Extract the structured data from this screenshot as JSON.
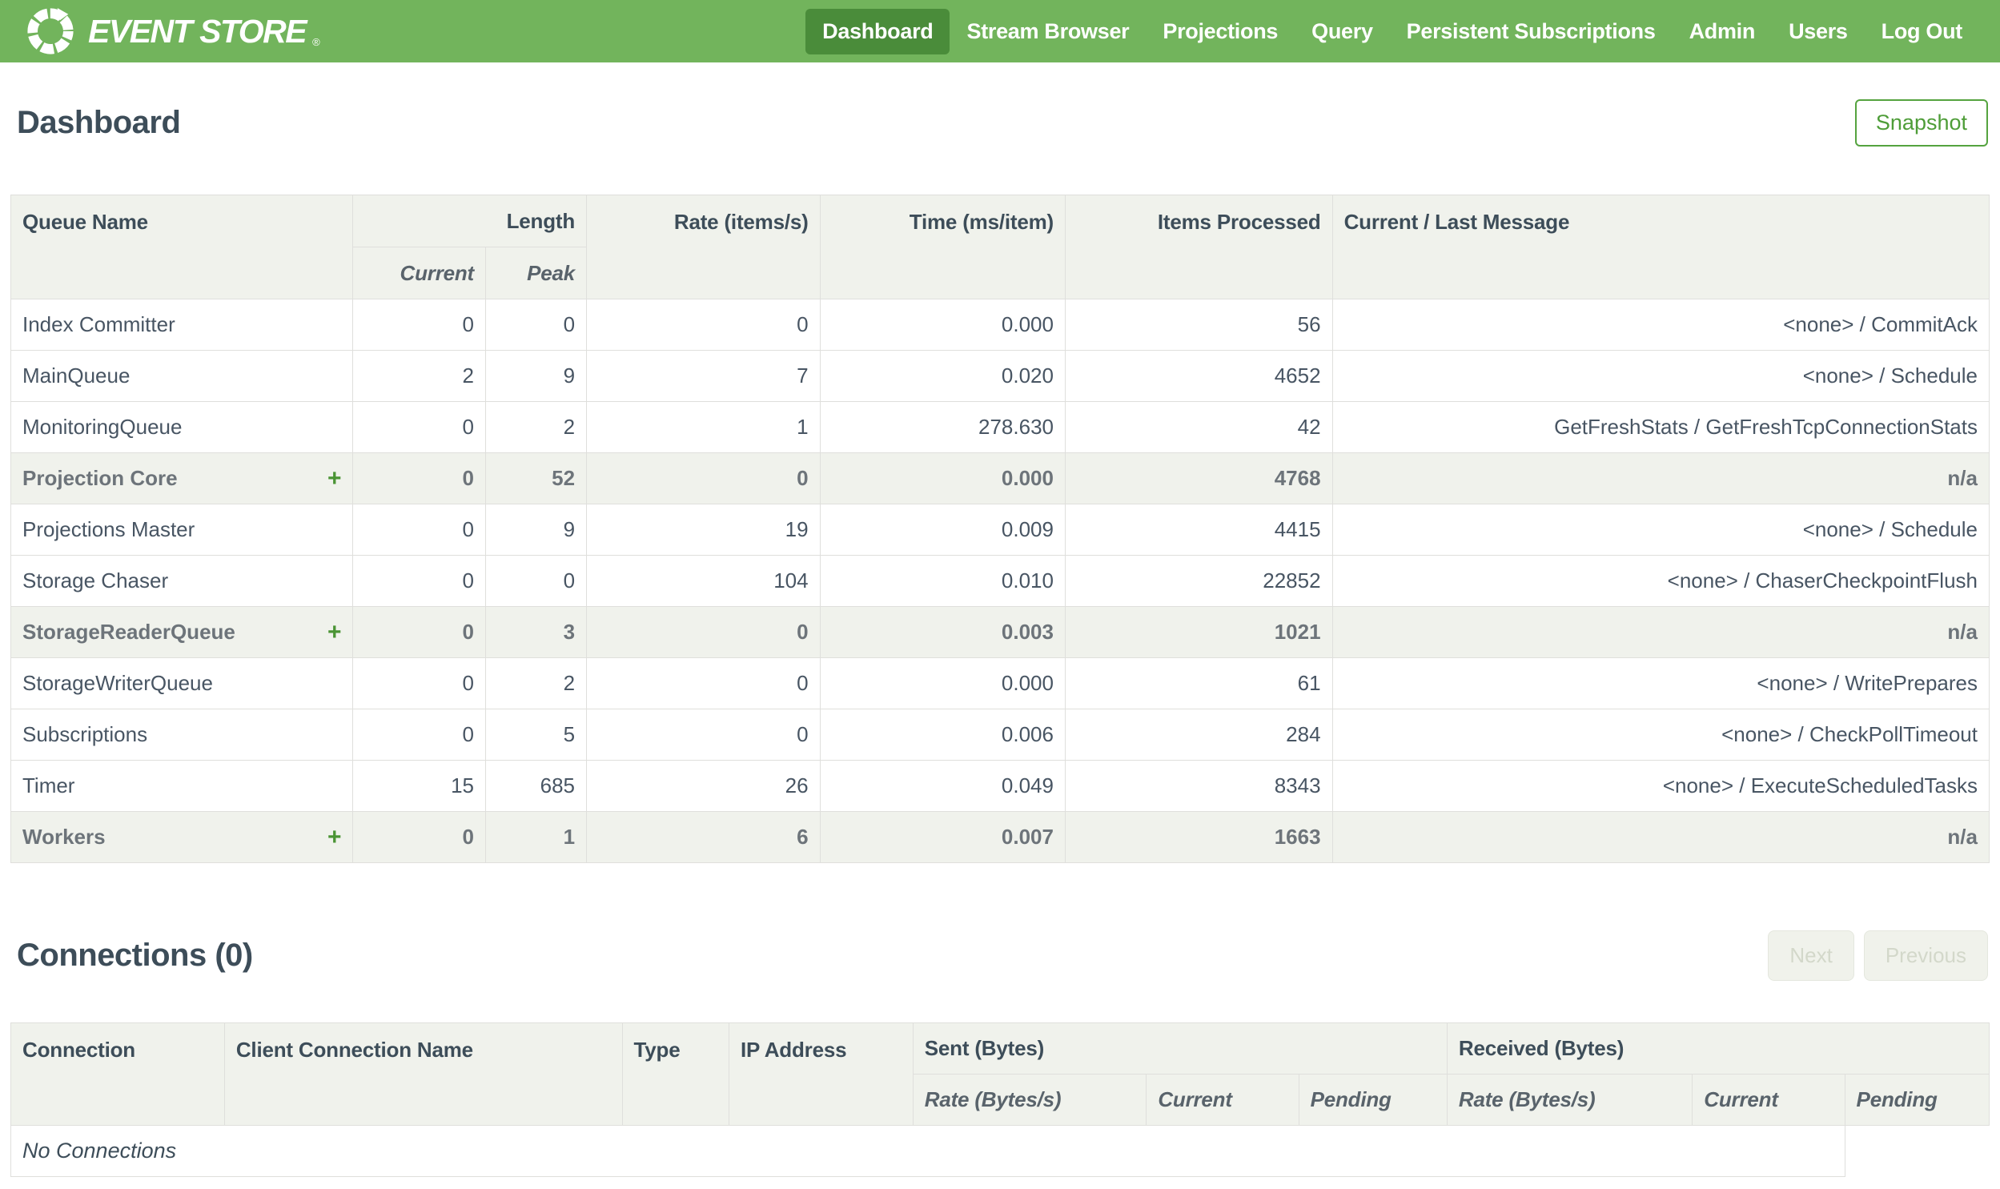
{
  "navbar": {
    "brand": "EVENT STORE",
    "brand_reg": "®",
    "items": [
      {
        "label": "Dashboard",
        "active": true
      },
      {
        "label": "Stream Browser",
        "active": false
      },
      {
        "label": "Projections",
        "active": false
      },
      {
        "label": "Query",
        "active": false
      },
      {
        "label": "Persistent Subscriptions",
        "active": false
      },
      {
        "label": "Admin",
        "active": false
      },
      {
        "label": "Users",
        "active": false
      },
      {
        "label": "Log Out",
        "active": false
      }
    ]
  },
  "page": {
    "title": "Dashboard",
    "snapshot_button": "Snapshot"
  },
  "queues": {
    "headers": {
      "queue_name": "Queue Name",
      "length": "Length",
      "current": "Current",
      "peak": "Peak",
      "rate": "Rate (items/s)",
      "time": "Time (ms/item)",
      "items_processed": "Items Processed",
      "message": "Current / Last Message"
    },
    "rows": [
      {
        "name": "Index Committer",
        "group": false,
        "expander": "",
        "current": "0",
        "peak": "0",
        "rate": "0",
        "time": "0.000",
        "items": "56",
        "message": "<none> / CommitAck"
      },
      {
        "name": "MainQueue",
        "group": false,
        "expander": "",
        "current": "2",
        "peak": "9",
        "rate": "7",
        "time": "0.020",
        "items": "4652",
        "message": "<none> / Schedule"
      },
      {
        "name": "MonitoringQueue",
        "group": false,
        "expander": "",
        "current": "0",
        "peak": "2",
        "rate": "1",
        "time": "278.630",
        "items": "42",
        "message": "GetFreshStats / GetFreshTcpConnectionStats"
      },
      {
        "name": "Projection Core",
        "group": true,
        "expander": "+",
        "current": "0",
        "peak": "52",
        "rate": "0",
        "time": "0.000",
        "items": "4768",
        "message": "n/a"
      },
      {
        "name": "Projections Master",
        "group": false,
        "expander": "",
        "current": "0",
        "peak": "9",
        "rate": "19",
        "time": "0.009",
        "items": "4415",
        "message": "<none> / Schedule"
      },
      {
        "name": "Storage Chaser",
        "group": false,
        "expander": "",
        "current": "0",
        "peak": "0",
        "rate": "104",
        "time": "0.010",
        "items": "22852",
        "message": "<none> / ChaserCheckpointFlush"
      },
      {
        "name": "StorageReaderQueue",
        "group": true,
        "expander": "+",
        "current": "0",
        "peak": "3",
        "rate": "0",
        "time": "0.003",
        "items": "1021",
        "message": "n/a"
      },
      {
        "name": "StorageWriterQueue",
        "group": false,
        "expander": "",
        "current": "0",
        "peak": "2",
        "rate": "0",
        "time": "0.000",
        "items": "61",
        "message": "<none> / WritePrepares"
      },
      {
        "name": "Subscriptions",
        "group": false,
        "expander": "",
        "current": "0",
        "peak": "5",
        "rate": "0",
        "time": "0.006",
        "items": "284",
        "message": "<none> / CheckPollTimeout"
      },
      {
        "name": "Timer",
        "group": false,
        "expander": "",
        "current": "15",
        "peak": "685",
        "rate": "26",
        "time": "0.049",
        "items": "8343",
        "message": "<none> / ExecuteScheduledTasks"
      },
      {
        "name": "Workers",
        "group": true,
        "expander": "+",
        "current": "0",
        "peak": "1",
        "rate": "6",
        "time": "0.007",
        "items": "1663",
        "message": "n/a"
      }
    ]
  },
  "connections": {
    "title": "Connections (0)",
    "next_button": "Next",
    "previous_button": "Previous",
    "headers": {
      "connection": "Connection",
      "client_connection_name": "Client Connection Name",
      "type": "Type",
      "ip_address": "IP Address",
      "sent": "Sent (Bytes)",
      "received": "Received (Bytes)",
      "rate_sent": "Rate (Bytes/s)",
      "current_sent": "Current",
      "pending_sent": "Pending",
      "rate_received": "Rate (Bytes/s)",
      "current_received": "Current",
      "pending_received": "Pending"
    },
    "empty_message": "No Connections"
  },
  "colors": {
    "navbar_green": "#72b45c",
    "active_nav_green": "#4a8c3a",
    "accent_green": "#4e9d38",
    "header_background": "#f0f2ec",
    "dark_text": "#3d4d59"
  }
}
